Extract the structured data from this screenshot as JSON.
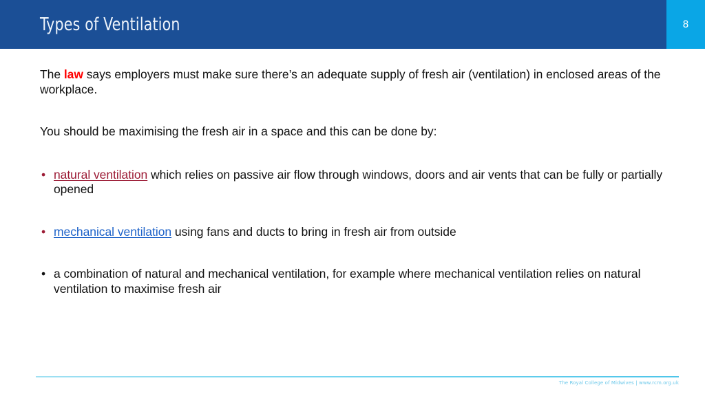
{
  "header": {
    "title": "Types of Ventilation",
    "page_number": "8",
    "band_color": "#1b4f96",
    "page_box_color": "#0aa6e6"
  },
  "body": {
    "paragraph_1": {
      "before": "The ",
      "emphasis": "law",
      "emphasis_color": "#ff0000",
      "after": " says employers must make sure there’s an adequate supply of fresh air (ventilation) in enclosed areas of the workplace."
    },
    "paragraph_2": "You should be maximising the fresh air in a space and this can be done by:",
    "bullets": [
      {
        "marker": "•",
        "marker_color": "#9c1b35",
        "link": "natural ventilation",
        "link_color": "#9c1b35",
        "text": " which relies on passive air flow through windows, doors and air vents that can be fully or partially opened"
      },
      {
        "marker": "•",
        "marker_color": "#9c1b35",
        "link": "mechanical ventilation",
        "link_color": "#1d62c9",
        "text": " using fans and ducts to bring in fresh air from outside"
      },
      {
        "marker": "•",
        "marker_color": "#111111",
        "link": "",
        "link_color": "#111111",
        "text": "a combination of natural and mechanical ventilation, for example where mechanical ventilation relies on natural ventilation to maximise fresh air"
      }
    ]
  },
  "footer": {
    "text": "The Royal College of Midwives | www.rcm.org.uk",
    "text_color": "#6ec9ea",
    "rule_color": "#6fd3ef"
  }
}
